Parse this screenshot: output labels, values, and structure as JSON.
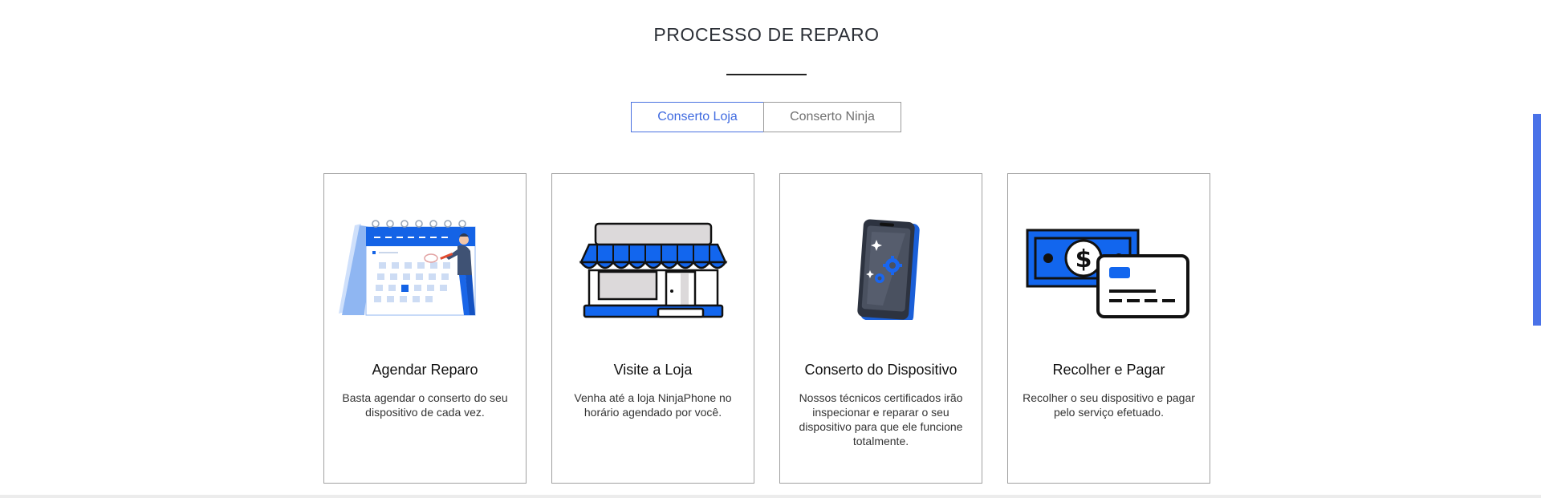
{
  "section": {
    "title": "PROCESSO DE REPARO"
  },
  "tabs": [
    {
      "label": "Conserto Loja",
      "active": true
    },
    {
      "label": "Conserto Ninja",
      "active": false
    }
  ],
  "steps": [
    {
      "title": "Agendar Reparo",
      "text": "Basta agendar o conserto do seu dispositivo de cada vez.",
      "icon": "calendar-illustration"
    },
    {
      "title": "Visite a Loja",
      "text": "Venha até a loja NinjaPhone no horário agendado por você.",
      "icon": "store-illustration"
    },
    {
      "title": "Conserto do Dispositivo",
      "text": "Nossos técnicos certificados irão inspecionar e reparar o seu dispositivo para que ele funcione totalmente.",
      "icon": "phone-repair-illustration"
    },
    {
      "title": "Recolher e Pagar",
      "text": "Recolher o seu dispositivo e pagar pelo serviço efetuado.",
      "icon": "payment-illustration"
    }
  ],
  "colors": {
    "accent": "#0a66e8",
    "tab_active": "#4a72e0",
    "scrollbar": "#4a72e8"
  }
}
